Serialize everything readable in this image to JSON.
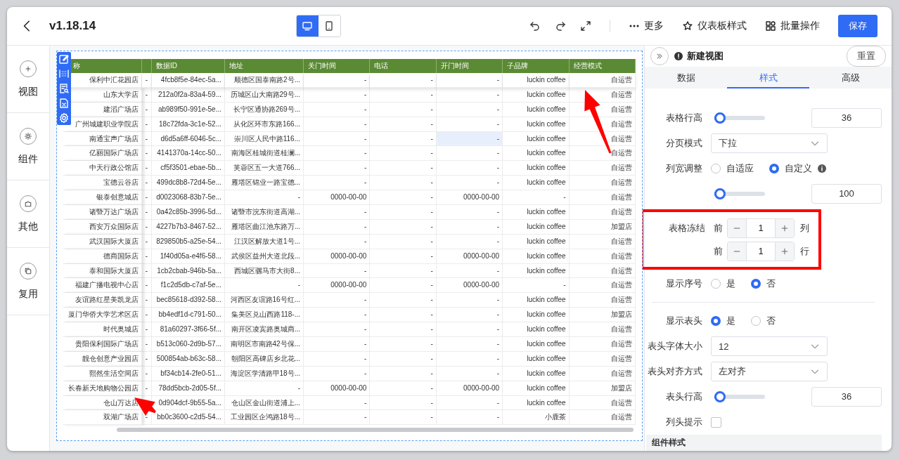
{
  "header": {
    "title": "v1.18.14",
    "view_modes": [
      {
        "kind": "desktop",
        "selected": true
      },
      {
        "kind": "mobile",
        "selected": false
      }
    ],
    "actions": [
      {
        "kind": "more",
        "label": "更多"
      },
      {
        "kind": "style",
        "label": "仪表板样式"
      },
      {
        "kind": "batch",
        "label": "批量操作"
      }
    ],
    "save_button": "保存"
  },
  "sidebar": {
    "items": [
      {
        "kind": "view",
        "label": "视图"
      },
      {
        "kind": "component",
        "label": "组件"
      },
      {
        "kind": "other",
        "label": "其他"
      },
      {
        "kind": "reuse",
        "label": "复用"
      }
    ]
  },
  "table": {
    "columns": [
      {
        "label": "称"
      },
      {},
      {
        "label": "数据ID"
      },
      {
        "label": "地址"
      },
      {
        "label": "关门时间"
      },
      {
        "label": "电话"
      },
      {
        "label": "开门时间"
      },
      {
        "label": "子品牌"
      },
      {
        "label": "经营模式"
      }
    ],
    "rows": [
      {
        "cells": [
          "保利中汇花园店",
          "-",
          "4fcb8f5e-84ec-5a...",
          "顺德区国泰南路2号...",
          "-",
          "-",
          "-",
          "luckin coffee",
          "自运营"
        ]
      },
      {
        "cells": [
          "山东大学店",
          "-",
          "212a0f2a-83a4-59...",
          "历城区山大南路29号...",
          "-",
          "-",
          "-",
          "luckin coffee",
          "自运营"
        ]
      },
      {
        "cells": [
          "建滔广场店",
          "-",
          "ab989f50-991e-5e...",
          "长宁区通协路269号...",
          "-",
          "-",
          "-",
          "luckin coffee",
          "自运营"
        ]
      },
      {
        "cells": [
          "广州城建职业学院店",
          "-",
          "18c72fda-3c1e-52...",
          "从化区环市东路166...",
          "-",
          "-",
          "-",
          "luckin coffee",
          "自运营"
        ]
      },
      {
        "cells": [
          "南通宝声广场店",
          "-",
          "d6d5a6ff-6046-5c...",
          "崇川区人民中路116...",
          "-",
          "-",
          {
            "text": "-",
            "highlighted": true
          },
          "luckin coffee",
          "自运营"
        ]
      },
      {
        "cells": [
          "亿丽国际广场店",
          "-",
          "4141370a-14cc-50...",
          "南海区桂城街道桂澜...",
          "-",
          "-",
          "-",
          "luckin coffee",
          "自运营"
        ]
      },
      {
        "cells": [
          "中天行政公馆店",
          "-",
          "cf5f3501-ebae-5b...",
          "芙蓉区五一大道766...",
          "-",
          "-",
          "-",
          "luckin coffee",
          "自运营"
        ]
      },
      {
        "cells": [
          "宝德云谷店",
          "-",
          "499dc8b8-72d4-5e...",
          "雁塔区锦业一路宝德...",
          "-",
          "-",
          "-",
          "luckin coffee",
          "自运营"
        ]
      },
      {
        "cells": [
          "银泰创意城店",
          "-",
          "d0023068-83b7-5e...",
          "-",
          "0000-00-00",
          "-",
          "0000-00-00",
          "-",
          "自运营"
        ]
      },
      {
        "cells": [
          "诸暨万达广场店",
          "-",
          "0a42c85b-3996-5d...",
          "诸暨市浣东街道高湖...",
          "-",
          "-",
          "-",
          "luckin coffee",
          "自运营"
        ]
      },
      {
        "cells": [
          "西安万众国际店",
          "-",
          "4227b7b3-8467-52...",
          "雁塔区曲江池东路万...",
          "-",
          "-",
          "-",
          "luckin coffee",
          "加盟店"
        ]
      },
      {
        "cells": [
          "武汉国际大厦店",
          "-",
          "829850b5-a25e-54...",
          "江汉区解放大道1号...",
          "-",
          "-",
          "-",
          "luckin coffee",
          "自运营"
        ]
      },
      {
        "cells": [
          "德商国际店",
          "-",
          "1f40d05a-e4f6-58...",
          "武侯区益州大道北段...",
          "0000-00-00",
          "-",
          "0000-00-00",
          "luckin coffee",
          "自运营"
        ]
      },
      {
        "cells": [
          "泰和国际大厦店",
          "-",
          "1cb2cbab-946b-5a...",
          "西城区骡马市大街8...",
          "-",
          "-",
          "-",
          "luckin coffee",
          "自运营"
        ]
      },
      {
        "cells": [
          "福建广播电视中心店",
          "-",
          "f1c2d5db-c7af-5e...",
          "-",
          "0000-00-00",
          "-",
          "0000-00-00",
          "-",
          "自运营"
        ]
      },
      {
        "cells": [
          "友谊路红星美凯龙店",
          "-",
          "bec85618-d392-58...",
          "河西区友谊路16号红...",
          "-",
          "-",
          "-",
          "luckin coffee",
          "自运营"
        ]
      },
      {
        "cells": [
          "厦门华侨大学艺术区店",
          "-",
          "bb4edf1d-c791-50...",
          "集美区兑山西路118-...",
          "-",
          "-",
          "-",
          "luckin coffee",
          "加盟店"
        ]
      },
      {
        "cells": [
          "时代奥城店",
          "-",
          "81a60297-3f66-5f...",
          "南开区凌宾路奥城商...",
          "-",
          "-",
          "-",
          "luckin coffee",
          "自运营"
        ]
      },
      {
        "cells": [
          "贵阳保利国际广场店",
          "-",
          "b513c060-2d9b-57...",
          "南明区市南路42号保...",
          "-",
          "-",
          "-",
          "luckin coffee",
          "自运营"
        ]
      },
      {
        "cells": [
          "靓仓创意产业园店",
          "-",
          "500854ab-b63c-58...",
          "朝阳区高碑店乡北花...",
          "-",
          "-",
          "-",
          "luckin coffee",
          "自运营"
        ]
      },
      {
        "cells": [
          "熙然生活空间店",
          "-",
          "bf34cb14-2fe0-51...",
          "海淀区学清路甲18号...",
          "-",
          "-",
          "-",
          "luckin coffee",
          "自运营"
        ]
      },
      {
        "cells": [
          "长春新天地购物公园店",
          "-",
          "78dd5bcb-2d05-5f...",
          "-",
          "0000-00-00",
          "-",
          "0000-00-00",
          "luckin coffee",
          "加盟店"
        ]
      },
      {
        "cells": [
          "仓山万达店",
          null,
          "0d904dcf-9b55-5a...",
          "仓山区金山街道浦上...",
          "-",
          "-",
          "-",
          "luckin coffee",
          "自运营"
        ]
      },
      {
        "cells": [
          "双湖广场店",
          "-",
          "bb0c3600-c2d5-54...",
          "工业园区企鸿路18号...",
          "-",
          "-",
          "-",
          "小鹿茶",
          "自运营"
        ]
      }
    ]
  },
  "panel": {
    "title": "新建视图",
    "reset_button": "重置",
    "tabs": [
      {
        "label": "数据",
        "selected": false
      },
      {
        "label": "样式",
        "selected": true
      },
      {
        "label": "高级",
        "selected": false
      }
    ],
    "settings": [
      {
        "kind": "slider",
        "label": "表格行高",
        "level": 0.05,
        "value": "36"
      },
      {
        "kind": "select",
        "label": "分页模式",
        "value": "下拉"
      },
      {
        "kind": "radio",
        "label": "列宽调整",
        "options": [
          {
            "label": "自适应",
            "selected": false
          },
          {
            "label": "自定义",
            "selected": true,
            "info": true
          }
        ]
      },
      {
        "kind": "slider",
        "level": 0.05,
        "value": "100"
      },
      {
        "kind": "freeze",
        "label": "表格冻结",
        "highlighted": true,
        "steppers": [
          {
            "prefix": "前",
            "value": "1",
            "suffix": "列"
          },
          {
            "prefix": "前",
            "value": "1",
            "suffix": "行"
          }
        ]
      },
      {
        "kind": "radio",
        "label": "显示序号",
        "options": [
          {
            "label": "是",
            "selected": false
          },
          {
            "label": "否",
            "selected": true
          }
        ]
      },
      {
        "kind": "divider"
      },
      {
        "kind": "radio",
        "label": "显示表头",
        "options": [
          {
            "label": "是",
            "selected": true
          },
          {
            "label": "否",
            "selected": false
          }
        ]
      },
      {
        "kind": "select",
        "label": "表头字体大小",
        "value": "12"
      },
      {
        "kind": "select",
        "label": "表头对齐方式",
        "value": "左对齐"
      },
      {
        "kind": "slider",
        "label": "表头行高",
        "level": 0.05,
        "value": "36"
      },
      {
        "kind": "checkbox",
        "label": "列头提示",
        "checked": false
      }
    ],
    "section_title": "组件样式"
  }
}
